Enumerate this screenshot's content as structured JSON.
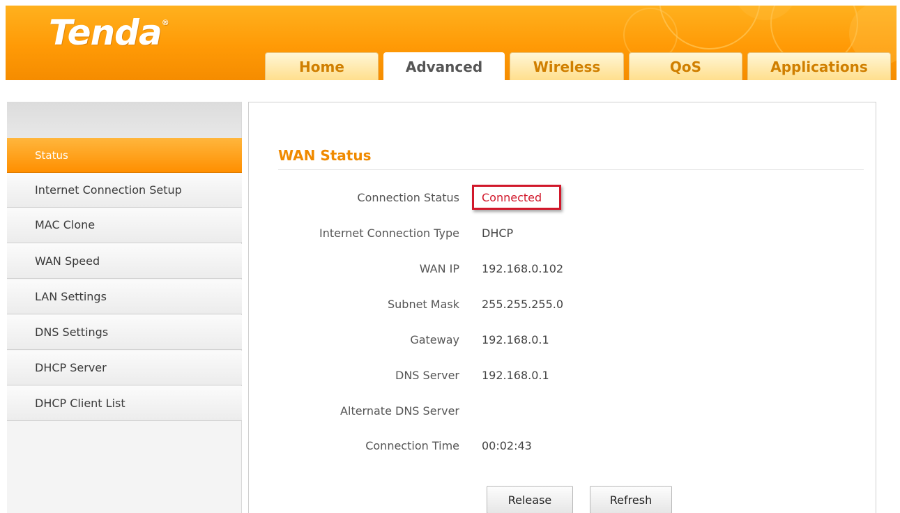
{
  "brand": {
    "logo_text": "Tenda",
    "logo_mark": "®"
  },
  "tabs": [
    {
      "label": "Home",
      "active": false
    },
    {
      "label": "Advanced",
      "active": true
    },
    {
      "label": "Wireless",
      "active": false
    },
    {
      "label": "QoS",
      "active": false
    },
    {
      "label": "Applications",
      "active": false
    }
  ],
  "sidebar": {
    "items": [
      {
        "label": "Status",
        "active": true
      },
      {
        "label": "Internet Connection Setup",
        "active": false
      },
      {
        "label": "MAC Clone",
        "active": false
      },
      {
        "label": "WAN Speed",
        "active": false
      },
      {
        "label": "LAN Settings",
        "active": false
      },
      {
        "label": "DNS Settings",
        "active": false
      },
      {
        "label": "DHCP Server",
        "active": false
      },
      {
        "label": "DHCP Client List",
        "active": false
      }
    ]
  },
  "main": {
    "section_title": "WAN Status",
    "rows": [
      {
        "label": "Connection Status",
        "value": "Connected"
      },
      {
        "label": "Internet Connection Type",
        "value": "DHCP"
      },
      {
        "label": "WAN IP",
        "value": "192.168.0.102"
      },
      {
        "label": "Subnet Mask",
        "value": "255.255.255.0"
      },
      {
        "label": "Gateway",
        "value": "192.168.0.1"
      },
      {
        "label": "DNS Server",
        "value": "192.168.0.1"
      },
      {
        "label": "Alternate DNS Server",
        "value": ""
      },
      {
        "label": "Connection Time",
        "value": "00:02:43"
      }
    ],
    "buttons": {
      "release": "Release",
      "refresh": "Refresh"
    }
  },
  "colors": {
    "brand_orange": "#ff9a06",
    "tab_text": "#d07f00",
    "status_red": "#d1172a",
    "title_orange": "#f08a00"
  }
}
